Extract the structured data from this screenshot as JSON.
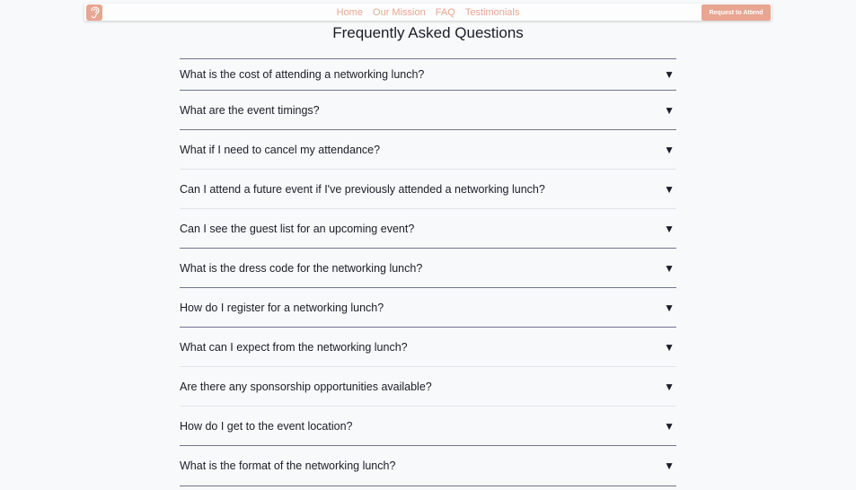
{
  "nav": {
    "links": [
      "Home",
      "Our Mission",
      "FAQ",
      "Testimonials"
    ],
    "cta_label": "Request to Attend",
    "logo_icon": "ear-icon",
    "accent_color": "#e8a592"
  },
  "page": {
    "title": "Frequently Asked Questions"
  },
  "faq": {
    "items": [
      "What is the cost of attending a networking lunch?",
      "What are the event timings?",
      "What if I need to cancel my attendance?",
      "Can I attend a future event if I've previously attended a networking lunch?",
      "Can I see the guest list for an upcoming event?",
      "What is the dress code for the networking lunch?",
      "How do I register for a networking lunch?",
      "What can I expect from the networking lunch?",
      "Are there any sponsorship opportunities available?",
      "How do I get to the event location?",
      "What is the format of the networking lunch?"
    ],
    "arrow_glyph": "▼"
  }
}
